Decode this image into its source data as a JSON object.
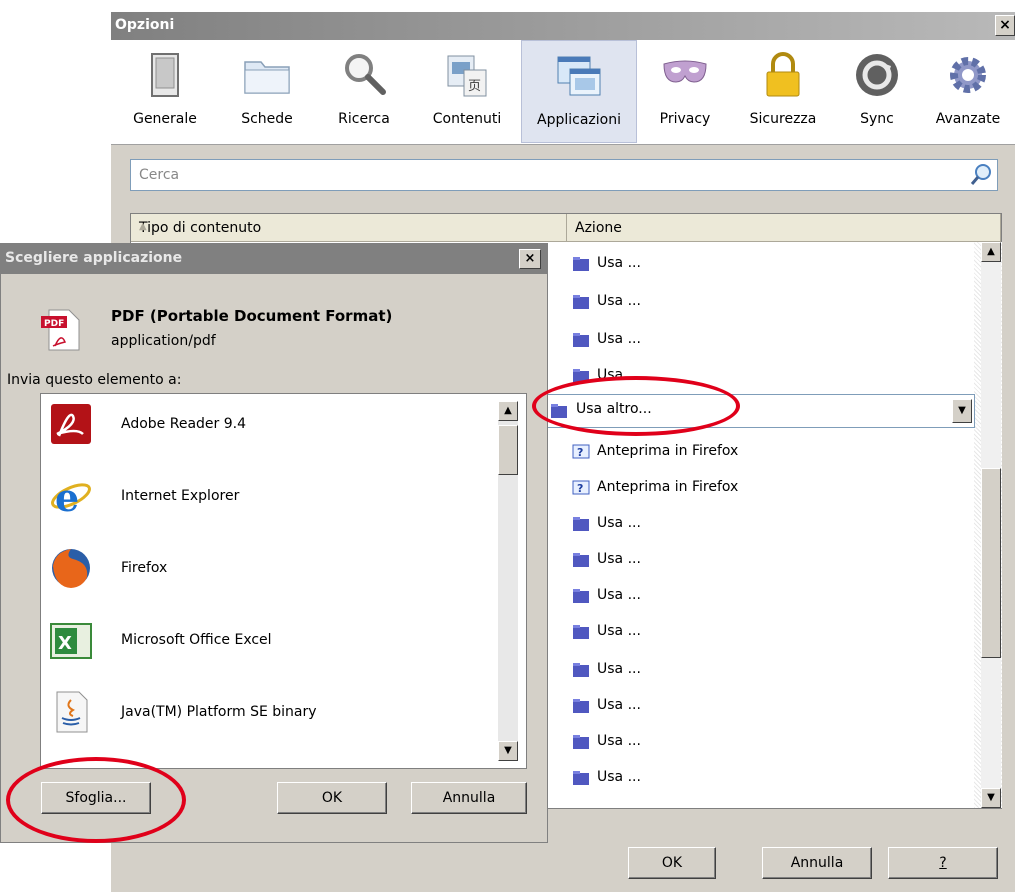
{
  "options_window": {
    "title": "Opzioni",
    "close_glyph": "×",
    "toolbar": [
      {
        "label": "Generale",
        "icon": "switch-icon"
      },
      {
        "label": "Schede",
        "icon": "folder-tabs-icon"
      },
      {
        "label": "Ricerca",
        "icon": "magnifier-icon"
      },
      {
        "label": "Contenuti",
        "icon": "content-icon"
      },
      {
        "label": "Applicazioni",
        "icon": "applications-icon",
        "selected": true
      },
      {
        "label": "Privacy",
        "icon": "mask-icon"
      },
      {
        "label": "Sicurezza",
        "icon": "padlock-icon"
      },
      {
        "label": "Sync",
        "icon": "sync-icon"
      },
      {
        "label": "Avanzate",
        "icon": "gear-icon"
      }
    ],
    "search_placeholder": "Cerca",
    "columns": {
      "content_type": "Tipo di contenuto",
      "action": "Azione"
    },
    "actions": [
      {
        "text": "Usa ...",
        "icon": "app-icon"
      },
      {
        "text": "Usa ...",
        "icon": "app-icon"
      },
      {
        "text": "Usa ...",
        "icon": "app-icon"
      },
      {
        "text": "Usa",
        "icon": "app-icon"
      },
      {
        "text": "Anteprima in Firefox",
        "icon": "help-icon"
      },
      {
        "text": "Anteprima in Firefox",
        "icon": "help-icon"
      },
      {
        "text": "Usa ...",
        "icon": "app-icon"
      },
      {
        "text": "Usa ...",
        "icon": "app-icon"
      },
      {
        "text": "Usa ...",
        "icon": "app-icon"
      },
      {
        "text": "Usa ...",
        "icon": "app-icon"
      },
      {
        "text": "Usa ...",
        "icon": "app-icon"
      },
      {
        "text": "Usa ...",
        "icon": "app-icon"
      },
      {
        "text": "Usa ...",
        "icon": "app-icon"
      },
      {
        "text": "Usa ...",
        "icon": "app-icon"
      }
    ],
    "selected_action": "Usa altro...",
    "buttons": {
      "ok": "OK",
      "cancel": "Annulla",
      "help": "?"
    }
  },
  "dialog": {
    "title": "Scegliere applicazione",
    "close_glyph": "×",
    "file_type": "PDF (Portable Document Format)",
    "mime": "application/pdf",
    "send_label": "Invia questo elemento a:",
    "apps": [
      {
        "name": "Adobe Reader 9.4",
        "icon": "adobe-reader-icon"
      },
      {
        "name": "Internet Explorer",
        "icon": "internet-explorer-icon"
      },
      {
        "name": "Firefox",
        "icon": "firefox-icon"
      },
      {
        "name": "Microsoft Office Excel",
        "icon": "excel-icon"
      },
      {
        "name": "Java(TM) Platform SE binary",
        "icon": "java-icon"
      }
    ],
    "buttons": {
      "browse": "Sfoglia...",
      "ok": "OK",
      "cancel": "Annulla"
    }
  },
  "colors": {
    "annotation": "#e0001a",
    "selected_tab": "#dfe4f0"
  }
}
